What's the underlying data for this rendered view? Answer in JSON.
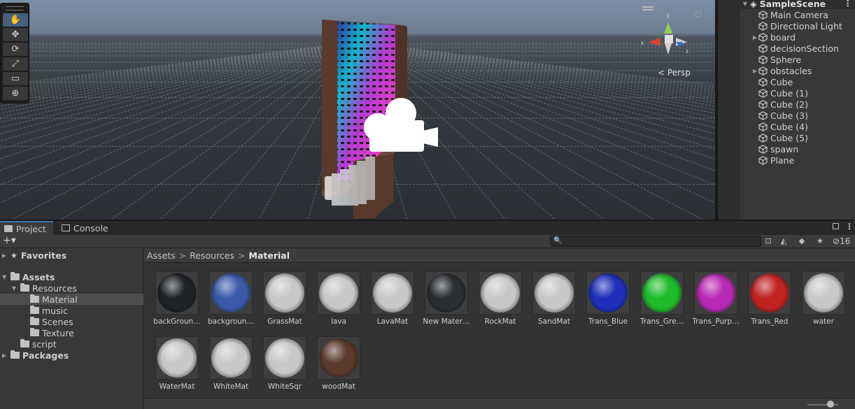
{
  "scene": {
    "view_mode": "Persp",
    "gizmo_axes": [
      "y",
      "x",
      "z"
    ],
    "tools": [
      {
        "name": "hand-tool",
        "glyph": "✋"
      },
      {
        "name": "move-tool",
        "glyph": "✥"
      },
      {
        "name": "rotate-tool",
        "glyph": "⟳"
      },
      {
        "name": "scale-tool",
        "glyph": "⤢"
      },
      {
        "name": "rect-tool",
        "glyph": "▭"
      },
      {
        "name": "transform-tool",
        "glyph": "⊕"
      }
    ]
  },
  "hierarchy": {
    "scene_name": "SampleScene",
    "items": [
      {
        "label": "Main Camera",
        "expandable": false
      },
      {
        "label": "Directional Light",
        "expandable": false
      },
      {
        "label": "board",
        "expandable": true
      },
      {
        "label": "decisionSection",
        "expandable": false
      },
      {
        "label": "Sphere",
        "expandable": false
      },
      {
        "label": "obstacles",
        "expandable": true
      },
      {
        "label": "Cube",
        "expandable": false
      },
      {
        "label": "Cube (1)",
        "expandable": false
      },
      {
        "label": "Cube (2)",
        "expandable": false
      },
      {
        "label": "Cube (3)",
        "expandable": false
      },
      {
        "label": "Cube (4)",
        "expandable": false
      },
      {
        "label": "Cube (5)",
        "expandable": false
      },
      {
        "label": "spawn",
        "expandable": false
      },
      {
        "label": "Plane",
        "expandable": false
      }
    ]
  },
  "bottom": {
    "tabs": [
      {
        "label": "Project",
        "active": true
      },
      {
        "label": "Console",
        "active": false
      }
    ],
    "add_label": "+▾",
    "search": {
      "placeholder": "",
      "icon": "🔍"
    },
    "hidden_count": "16",
    "tree": [
      {
        "label": "Favorites",
        "level": 0,
        "arrow": "▶",
        "icon": "star",
        "bold": true,
        "selected": false
      },
      {
        "label": "Assets",
        "level": 0,
        "arrow": "▼",
        "icon": "folder",
        "bold": true,
        "selected": false
      },
      {
        "label": "Resources",
        "level": 1,
        "arrow": "▼",
        "icon": "folder",
        "bold": false,
        "selected": false
      },
      {
        "label": "Material",
        "level": 2,
        "arrow": "",
        "icon": "folder",
        "bold": false,
        "selected": true
      },
      {
        "label": "music",
        "level": 2,
        "arrow": "",
        "icon": "folder",
        "bold": false,
        "selected": false
      },
      {
        "label": "Scenes",
        "level": 2,
        "arrow": "",
        "icon": "folder",
        "bold": false,
        "selected": false
      },
      {
        "label": "Texture",
        "level": 2,
        "arrow": "",
        "icon": "folder",
        "bold": false,
        "selected": false
      },
      {
        "label": "script",
        "level": 1,
        "arrow": "",
        "icon": "folder",
        "bold": false,
        "selected": false
      },
      {
        "label": "Packages",
        "level": 0,
        "arrow": "▶",
        "icon": "folder",
        "bold": true,
        "selected": false
      }
    ],
    "breadcrumb": [
      "Assets",
      "Resources",
      "Material"
    ],
    "assets": [
      {
        "label": "backGroun…",
        "color": "#1f2226"
      },
      {
        "label": "backgroun…",
        "color": "#3a5aa8"
      },
      {
        "label": "GrassMat",
        "color": "#c8c8c8"
      },
      {
        "label": "lava",
        "color": "#c8c8c8"
      },
      {
        "label": "LavaMat",
        "color": "#c8c8c8"
      },
      {
        "label": "New Mater…",
        "color": "#2a2d31"
      },
      {
        "label": "RockMat",
        "color": "#c8c8c8"
      },
      {
        "label": "SandMat",
        "color": "#c8c8c8"
      },
      {
        "label": "Trans_Blue",
        "color": "#1f2fb8"
      },
      {
        "label": "Trans_Gre…",
        "color": "#1fbb2a"
      },
      {
        "label": "Trans_Purp…",
        "color": "#b82ab5"
      },
      {
        "label": "Trans_Red",
        "color": "#c02222"
      },
      {
        "label": "water",
        "color": "#c8c8c8"
      },
      {
        "label": "WaterMat",
        "color": "#c8c8c8"
      },
      {
        "label": "WhiteMat",
        "color": "#c8c8c8"
      },
      {
        "label": "WhiteSqr",
        "color": "#c8c8c8"
      },
      {
        "label": "woodMat",
        "color": "#5a3a2c"
      }
    ]
  }
}
